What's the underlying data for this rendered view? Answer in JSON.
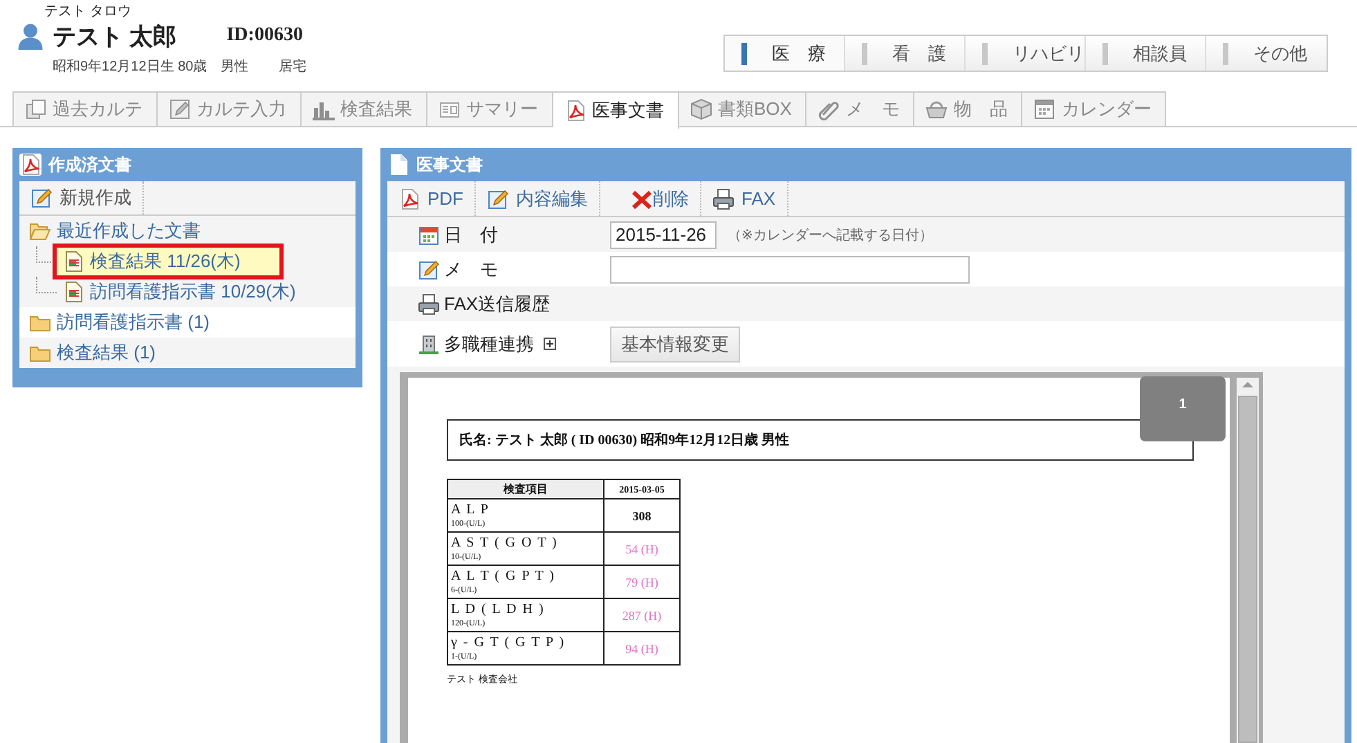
{
  "patient": {
    "kana": "テスト タロウ",
    "name": "テスト 太郎",
    "id": "ID:00630",
    "birth": "昭和9年12月12日生 80歳",
    "sex": "男性",
    "residence": "居宅"
  },
  "categories": [
    {
      "label": "医　療",
      "selected": true
    },
    {
      "label": "看　護",
      "selected": false
    },
    {
      "label": "リハビリ",
      "selected": false
    },
    {
      "label": "相談員",
      "selected": false
    },
    {
      "label": "その他",
      "selected": false
    }
  ],
  "tabs": [
    {
      "label": "過去カルテ",
      "selected": false
    },
    {
      "label": "カルテ入力",
      "selected": false
    },
    {
      "label": "検査結果",
      "selected": false
    },
    {
      "label": "サマリー",
      "selected": false
    },
    {
      "label": "医事文書",
      "selected": true
    },
    {
      "label": "書類BOX",
      "selected": false
    },
    {
      "label": "メ　モ",
      "selected": false
    },
    {
      "label": "物　品",
      "selected": false
    },
    {
      "label": "カレンダー",
      "selected": false
    }
  ],
  "left_panel": {
    "title": "作成済文書",
    "new_button": "新規作成",
    "tree": [
      {
        "label": "最近作成した文書",
        "expanded": true,
        "children": [
          {
            "label": "検査結果 11/26(木)",
            "selected": true
          },
          {
            "label": "訪問看護指示書 10/29(木)",
            "selected": false
          }
        ]
      },
      {
        "label": "訪問看護指示書 (1)",
        "expanded": false
      },
      {
        "label": "検査結果 (1)",
        "expanded": false
      }
    ]
  },
  "right_panel": {
    "title": "医事文書",
    "toolbar": [
      "PDF",
      "内容編集",
      "削除",
      "FAX"
    ],
    "date_label": "日　付",
    "date_value": "2015-11-26",
    "date_note": "（※カレンダーへ記載する日付）",
    "memo_label": "メ　モ",
    "fax_history": "FAX送信履歴",
    "collab_label": "多職種連携",
    "collab_expanded": false,
    "collab_button": "基本情報変更",
    "preview": {
      "page_marker": "1",
      "header": "氏名: テスト  太郎 ( ID 00630) 昭和9年12月12日歳 男性",
      "columns": [
        "検査項目",
        "2015-03-05"
      ],
      "rows": [
        {
          "item": "A L P",
          "range": "100-(U/L)",
          "value": "308",
          "high": false
        },
        {
          "item": "A S T ( G O T )",
          "range": "10-(U/L)",
          "value": "54 (H)",
          "high": true
        },
        {
          "item": "A L T ( G P T )",
          "range": "6-(U/L)",
          "value": "79 (H)",
          "high": true
        },
        {
          "item": "L D ( L D H )",
          "range": "120-(U/L)",
          "value": "287 (H)",
          "high": true
        },
        {
          "item": "γ - G T ( G T P )",
          "range": "1-(U/L)",
          "value": "94 (H)",
          "high": true
        }
      ],
      "footer": "テスト 検査会社"
    }
  }
}
